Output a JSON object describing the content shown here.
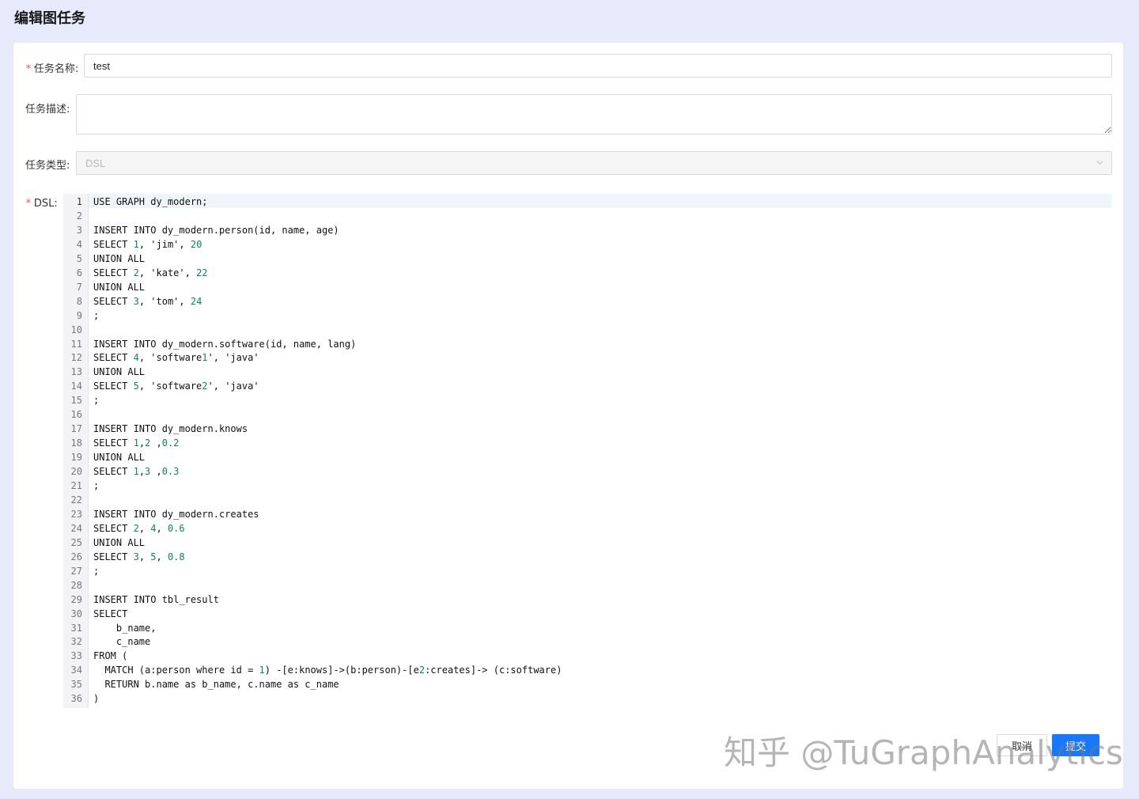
{
  "page": {
    "title": "编辑图任务"
  },
  "form": {
    "name_label": "任务名称:",
    "name_value": "test",
    "desc_label": "任务描述:",
    "desc_value": "",
    "type_label": "任务类型:",
    "type_value": "DSL",
    "dsl_label": "DSL:",
    "required_mark": "*"
  },
  "editor": {
    "active_line": 1,
    "lines": [
      [
        [
          "USE GRAPH dy_modern;",
          "p"
        ]
      ],
      [],
      [
        [
          "INSERT INTO dy_modern.person(id, name, age)",
          "p"
        ]
      ],
      [
        [
          "SELECT ",
          "p"
        ],
        [
          "1",
          "n"
        ],
        [
          ", ",
          "p"
        ],
        [
          "'jim'",
          "p"
        ],
        [
          ", ",
          "p"
        ],
        [
          "20",
          "n"
        ]
      ],
      [
        [
          "UNION ALL",
          "p"
        ]
      ],
      [
        [
          "SELECT ",
          "p"
        ],
        [
          "2",
          "n"
        ],
        [
          ", ",
          "p"
        ],
        [
          "'kate'",
          "p"
        ],
        [
          ", ",
          "p"
        ],
        [
          "22",
          "n"
        ]
      ],
      [
        [
          "UNION ALL",
          "p"
        ]
      ],
      [
        [
          "SELECT ",
          "p"
        ],
        [
          "3",
          "n"
        ],
        [
          ", ",
          "p"
        ],
        [
          "'tom'",
          "p"
        ],
        [
          ", ",
          "p"
        ],
        [
          "24",
          "n"
        ]
      ],
      [
        [
          ";",
          "p"
        ]
      ],
      [],
      [
        [
          "INSERT INTO dy_modern.software(id, name, lang)",
          "p"
        ]
      ],
      [
        [
          "SELECT ",
          "p"
        ],
        [
          "4",
          "n"
        ],
        [
          ", 'software",
          "p"
        ],
        [
          "1",
          "n"
        ],
        [
          "', 'java'",
          "p"
        ]
      ],
      [
        [
          "UNION ALL",
          "p"
        ]
      ],
      [
        [
          "SELECT ",
          "p"
        ],
        [
          "5",
          "n"
        ],
        [
          ", 'software",
          "p"
        ],
        [
          "2",
          "n"
        ],
        [
          "', 'java'",
          "p"
        ]
      ],
      [
        [
          ";",
          "p"
        ]
      ],
      [],
      [
        [
          "INSERT INTO dy_modern.knows",
          "p"
        ]
      ],
      [
        [
          "SELECT ",
          "p"
        ],
        [
          "1",
          "n"
        ],
        [
          ",",
          "p"
        ],
        [
          "2",
          "n"
        ],
        [
          " ,",
          "p"
        ],
        [
          "0.2",
          "n"
        ]
      ],
      [
        [
          "UNION ALL",
          "p"
        ]
      ],
      [
        [
          "SELECT ",
          "p"
        ],
        [
          "1",
          "n"
        ],
        [
          ",",
          "p"
        ],
        [
          "3",
          "n"
        ],
        [
          " ,",
          "p"
        ],
        [
          "0.3",
          "n"
        ]
      ],
      [
        [
          ";",
          "p"
        ]
      ],
      [],
      [
        [
          "INSERT INTO dy_modern.creates",
          "p"
        ]
      ],
      [
        [
          "SELECT ",
          "p"
        ],
        [
          "2",
          "n"
        ],
        [
          ", ",
          "p"
        ],
        [
          "4",
          "n"
        ],
        [
          ", ",
          "p"
        ],
        [
          "0.6",
          "n"
        ]
      ],
      [
        [
          "UNION ALL",
          "p"
        ]
      ],
      [
        [
          "SELECT ",
          "p"
        ],
        [
          "3",
          "n"
        ],
        [
          ", ",
          "p"
        ],
        [
          "5",
          "n"
        ],
        [
          ", ",
          "p"
        ],
        [
          "0.8",
          "n"
        ]
      ],
      [
        [
          ";",
          "p"
        ]
      ],
      [],
      [
        [
          "INSERT INTO tbl_result",
          "p"
        ]
      ],
      [
        [
          "SELECT",
          "p"
        ]
      ],
      [
        [
          "    b_name,",
          "p"
        ]
      ],
      [
        [
          "    c_name",
          "p"
        ]
      ],
      [
        [
          "FROM (",
          "p"
        ]
      ],
      [
        [
          "  MATCH (a:person where id = ",
          "p"
        ],
        [
          "1",
          "n"
        ],
        [
          ") -[e:knows]->(b:person)-[e",
          "p"
        ],
        [
          "2",
          "n"
        ],
        [
          ":creates]-> (c:software)",
          "p"
        ]
      ],
      [
        [
          "  RETURN b.name as b_name, c.name as c_name",
          "p"
        ]
      ],
      [
        [
          ")",
          "p"
        ]
      ]
    ]
  },
  "footer": {
    "cancel_label": "取消",
    "submit_label": "提交"
  },
  "watermark": "知乎 @TuGraphAnalytics",
  "colors": {
    "primary": "#1677ff",
    "number": "#09885a",
    "background": "#e6eafa"
  }
}
